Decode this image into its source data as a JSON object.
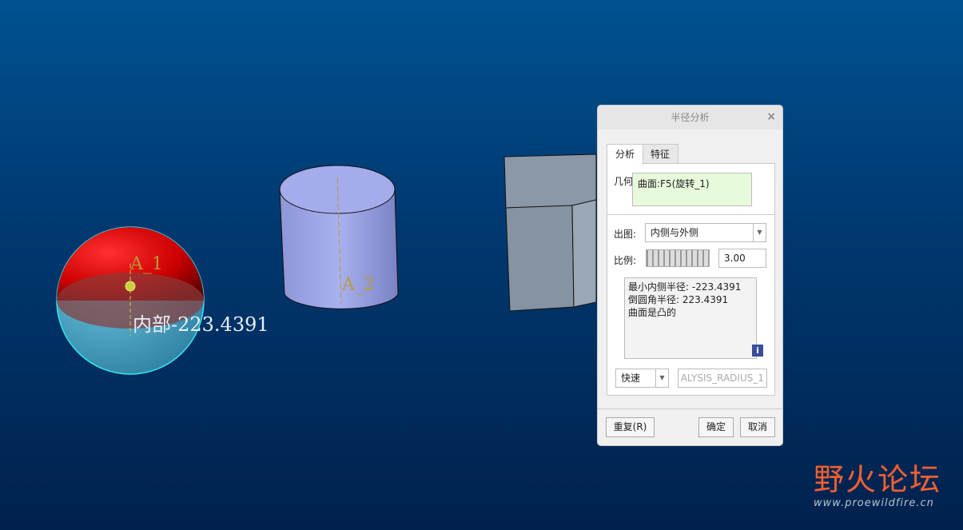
{
  "viewport": {
    "sphere_axis_label": "A_1",
    "cylinder_axis_label": "A_2",
    "measure_label": "内部-223.4391"
  },
  "dialog": {
    "title": "半径分析",
    "close": "×",
    "tabs": [
      {
        "label": "分析",
        "active": true
      },
      {
        "label": "特征",
        "active": false
      }
    ],
    "geometry_label": "几何:",
    "geometry_value": "曲面:F5(旋转_1)",
    "plot_label": "出图:",
    "plot_value": "内侧与外侧",
    "scale_label": "比例:",
    "scale_value": "3.00",
    "results": [
      "最小内侧半径: -223.4391",
      "倒圆角半径: 223.4391",
      "曲面是凸的"
    ],
    "info_icon": "i",
    "mode_value": "快速",
    "name_value": "ALYSIS_RADIUS_1",
    "repeat_button": "重复(R)",
    "ok_button": "确定",
    "cancel_button": "取消"
  },
  "watermark": {
    "title": "野火论坛",
    "url": "www.proewildfire.cn"
  }
}
